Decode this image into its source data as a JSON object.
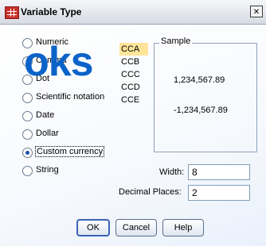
{
  "window": {
    "title": "Variable Type",
    "close_glyph": "✕"
  },
  "watermark": "oks",
  "radio_options": [
    {
      "label": "Numeric",
      "checked": false
    },
    {
      "label": "Comma",
      "checked": false
    },
    {
      "label": "Dot",
      "checked": false
    },
    {
      "label": "Scientific notation",
      "checked": false
    },
    {
      "label": "Date",
      "checked": false
    },
    {
      "label": "Dollar",
      "checked": false
    },
    {
      "label": "Custom currency",
      "checked": true
    },
    {
      "label": "String",
      "checked": false
    }
  ],
  "currency_list": [
    "CCA",
    "CCB",
    "CCC",
    "CCD",
    "CCE"
  ],
  "currency_selected": "CCA",
  "sample": {
    "legend": "Sample",
    "positive": "1,234,567.89",
    "negative": "-1,234,567.89"
  },
  "fields": {
    "width_label": "Width:",
    "width_value": "8",
    "decimal_label": "Decimal Places:",
    "decimal_value": "2"
  },
  "buttons": {
    "ok": "OK",
    "cancel": "Cancel",
    "help": "Help"
  },
  "colors": {
    "selection": "#ffe49a",
    "accent": "#1f4fa8",
    "watermark": "#0b63c9"
  }
}
